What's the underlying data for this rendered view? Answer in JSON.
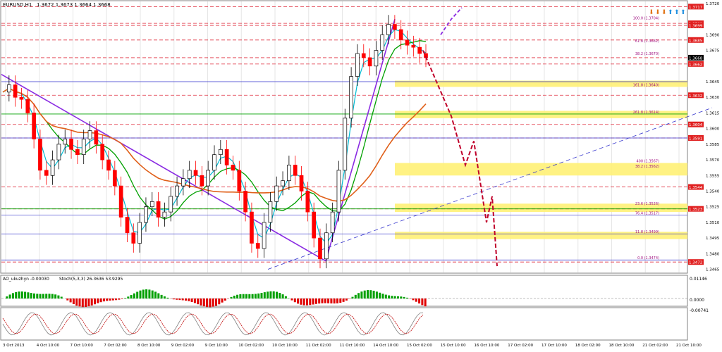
{
  "header": {
    "symbol": "EURUSD,H1",
    "ohlc": "1.3672 1.3673 1.3664 1.3668"
  },
  "indicator_panel": {
    "label_ao": "AO_ukuzhyn -0.00030",
    "label_stoch": "Stoch(5,3,3) 26.3636 53.9295",
    "scale": [
      "0.01146",
      "0.0000",
      "-0.00741"
    ]
  },
  "colors": {
    "bull_candle": "#000000",
    "bear_candle": "#ff0000",
    "ma_fast": "#00bcd4",
    "ma_mid": "#00a000",
    "ma_slow": "#e0601a",
    "channel": "#8a2be2",
    "projection": "#c0002a",
    "fib_zone": "#fff176",
    "current_price": "#000000"
  },
  "chart_data": {
    "type": "candlestick",
    "ylim": [
      1.3462,
      1.3722
    ],
    "price_scale": [
      "1.3720",
      "1.3690",
      "1.3675",
      "1.3645",
      "1.3630",
      "1.3615",
      "1.3600",
      "1.3585",
      "1.3570",
      "1.3555",
      "1.3540",
      "1.3525",
      "1.3510",
      "1.3495",
      "1.3480",
      "1.3465"
    ],
    "time_labels": [
      "3 Oct 2013",
      "4 Oct 10:00",
      "7 Oct 10:00",
      "7 Oct 02:00",
      "8 Oct 10:00",
      "9 Oct 02:00",
      "9 Oct 10:00",
      "10 Oct 02:00",
      "10 Oct 10:00",
      "11 Oct 02:00",
      "11 Oct 10:00",
      "14 Oct 10:00",
      "15 Oct 02:00",
      "15 Oct 10:00",
      "16 Oct 10:00",
      "17 Oct 02:00",
      "17 Oct 10:00",
      "18 Oct 02:00",
      "18 Oct 10:00",
      "21 Oct 02:00",
      "21 Oct 10:00"
    ],
    "close_series": [
      1.3635,
      1.3642,
      1.363,
      1.3628,
      1.3615,
      1.359,
      1.356,
      1.3555,
      1.357,
      1.3585,
      1.359,
      1.358,
      1.3575,
      1.359,
      1.3598,
      1.3585,
      1.357,
      1.356,
      1.3545,
      1.3515,
      1.35,
      1.349,
      1.351,
      1.3525,
      1.353,
      1.3515,
      1.352,
      1.3535,
      1.3545,
      1.3552,
      1.356,
      1.3555,
      1.3545,
      1.356,
      1.3575,
      1.358,
      1.3565,
      1.356,
      1.354,
      1.352,
      1.349,
      1.3485,
      1.351,
      1.353,
      1.3545,
      1.355,
      1.3565,
      1.3555,
      1.354,
      1.352,
      1.3495,
      1.3475,
      1.35,
      1.352,
      1.356,
      1.361,
      1.365,
      1.3672,
      1.3668,
      1.366,
      1.3675,
      1.369,
      1.37,
      1.3695,
      1.3685,
      1.368,
      1.3678,
      1.3672,
      1.3668
    ],
    "price_levels": [
      {
        "label": "1.3717",
        "price": 1.3717
      },
      {
        "label": "1.3701",
        "price": 1.3701
      },
      {
        "label": "1.3699",
        "price": 1.3699
      },
      {
        "label": "1.3685",
        "price": 1.3685
      },
      {
        "label": "1.3668",
        "price": 1.3668
      },
      {
        "label": "1.3662",
        "price": 1.3662
      },
      {
        "label": "1.3632",
        "price": 1.3632
      },
      {
        "label": "1.3604",
        "price": 1.3604
      },
      {
        "label": "1.3591",
        "price": 1.3591
      },
      {
        "label": "1.3544",
        "price": 1.3544
      },
      {
        "label": "1.3523",
        "price": 1.3523
      },
      {
        "label": "1.3472",
        "price": 1.3472
      }
    ],
    "fib_labels": [
      {
        "text": "100.0  (1.3704)",
        "price": 1.3704
      },
      {
        "text": "61.8  (1.3682)",
        "price": 1.3682
      },
      {
        "text": "38.2  (1.3670)",
        "price": 1.367
      },
      {
        "text": "161.8 (1.3640)",
        "price": 1.364
      },
      {
        "text": "261.8 (1.3614)",
        "price": 1.3614
      },
      {
        "text": "400 (1.3567)",
        "price": 1.3567
      },
      {
        "text": "38.2 (1.3562)",
        "price": 1.3562
      },
      {
        "text": "23.6 (1.3526)",
        "price": 1.3526
      },
      {
        "text": "76.4 (1.3517)",
        "price": 1.3517
      },
      {
        "text": "11.8 (1.3499)",
        "price": 1.3499
      },
      {
        "text": "0.0 (1.3474)",
        "price": 1.3474
      }
    ],
    "yellow_zones": [
      {
        "label": "1.3614",
        "from": 1.361,
        "to": 1.3617
      },
      {
        "label": "1.3645",
        "from": 1.364,
        "to": 1.3646
      },
      {
        "label": "1.3560",
        "from": 1.3555,
        "to": 1.3567
      },
      {
        "label": "1.3525",
        "from": 1.352,
        "to": 1.3528
      },
      {
        "label": "1.3499",
        "from": 1.3494,
        "to": 1.3501
      }
    ],
    "current_price": "1.3668"
  }
}
